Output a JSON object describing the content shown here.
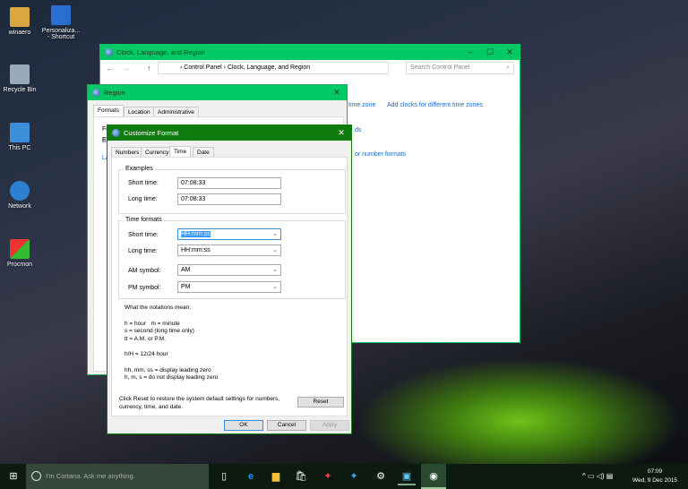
{
  "desktop": {
    "icons": [
      "winaero",
      "Personaliza... - Shortcut",
      "Recycle Bin",
      "This PC",
      "Network",
      "Procmon"
    ]
  },
  "control_panel": {
    "title": "Clock, Language, and Region",
    "breadcrumb": [
      "Control Panel",
      "Clock, Language, and Region"
    ],
    "search_placeholder": "Search Control Panel",
    "links": [
      "time zone",
      "Add clocks for different time zones",
      "ds",
      "or number formats"
    ]
  },
  "region": {
    "title": "Region",
    "tabs": [
      "Formats",
      "Location",
      "Administrative"
    ],
    "format_label": "Fo",
    "format_value": "E",
    "link": "La"
  },
  "customize": {
    "title": "Customize Format",
    "tabs": [
      "Numbers",
      "Currency",
      "Time",
      "Date"
    ],
    "active_tab": "Time",
    "examples": {
      "legend": "Examples",
      "short_label": "Short time:",
      "short_value": "07:08:33",
      "long_label": "Long time:",
      "long_value": "07:08:33"
    },
    "formats": {
      "legend": "Time formats",
      "short_label": "Short time:",
      "short_value": "HH:mm:ss",
      "long_label": "Long time:",
      "long_value": "HH:mm:ss",
      "am_label": "AM symbol:",
      "am_value": "AM",
      "pm_label": "PM symbol:",
      "pm_value": "PM"
    },
    "notations": [
      "What the notations mean:",
      "h = hour   m = minute",
      "s = second (long time only)",
      "tt = A.M. or P.M.",
      "h/H = 12/24 hour",
      "hh, mm, ss = display leading zero",
      "h, m, s = do not display leading zero"
    ],
    "reset_text": "Click Reset to restore the system default settings for numbers, currency, time, and date.",
    "reset": "Reset",
    "ok": "OK",
    "cancel": "Cancel",
    "apply": "Apply"
  },
  "taskbar": {
    "cortana": "I'm Cortana. Ask me anything.",
    "time": "07:09",
    "date": "Wed, 9 Dec 2015"
  },
  "colors": {
    "cp_title": "#00c965",
    "dialog_title": "#107c10",
    "link": "#1a68c8"
  }
}
